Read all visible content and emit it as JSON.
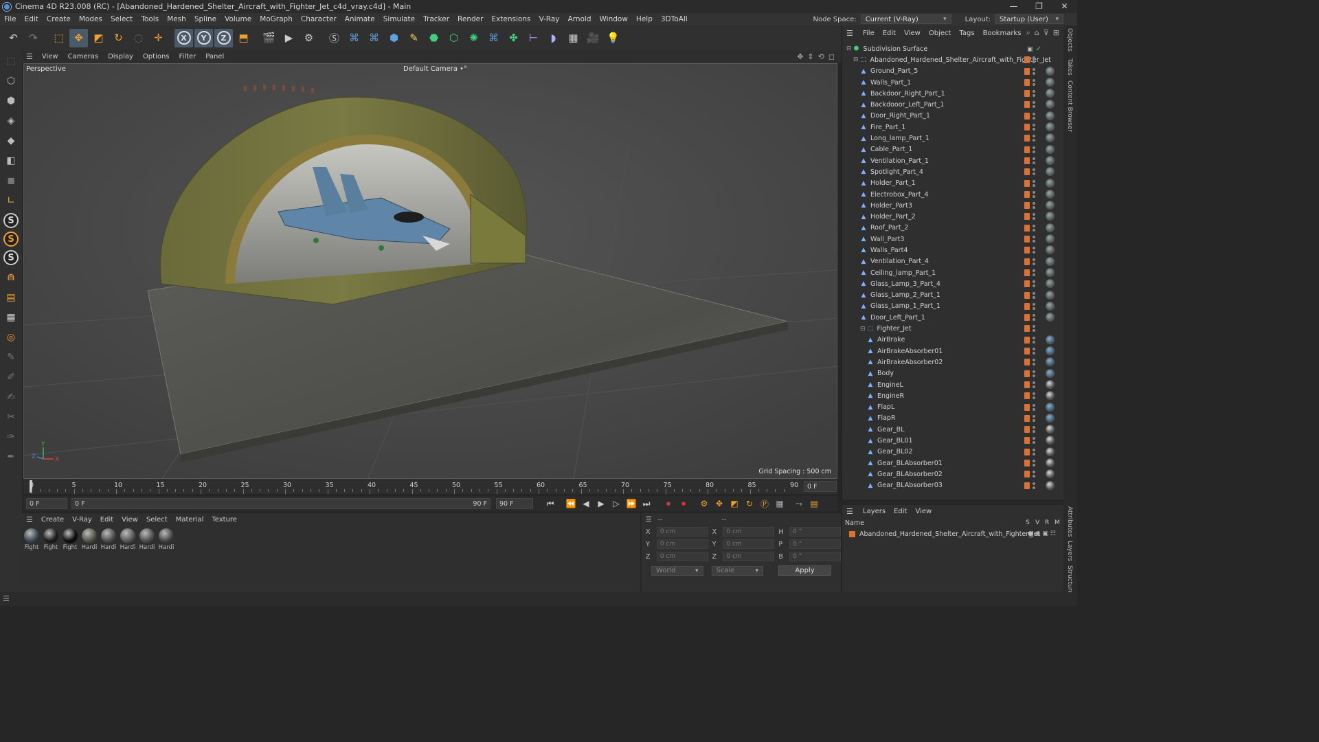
{
  "window": {
    "title": "Cinema 4D R23.008 (RC) - [Abandoned_Hardened_Shelter_Aircraft_with_Fighter_Jet_c4d_vray.c4d] - Main",
    "controls": [
      "—",
      "❐",
      "✕"
    ]
  },
  "menubar": {
    "items": [
      "File",
      "Edit",
      "Create",
      "Modes",
      "Select",
      "Tools",
      "Mesh",
      "Spline",
      "Volume",
      "MoGraph",
      "Character",
      "Animate",
      "Simulate",
      "Tracker",
      "Render",
      "Extensions",
      "V-Ray",
      "Arnold",
      "Window",
      "Help",
      "3DToAll"
    ],
    "node_space_label": "Node Space:",
    "node_space_value": "Current (V-Ray)",
    "layout_label": "Layout:",
    "layout_value": "Startup (User)"
  },
  "toolbar": {
    "icons": [
      "undo-icon",
      "redo-icon",
      "live-select-icon",
      "move-icon",
      "scale-icon",
      "rotate-icon",
      "recent-tools-icon",
      "transform-icon",
      "x-axis-icon",
      "y-axis-icon",
      "z-axis-icon",
      "coordinate-system-icon",
      "render-region-icon",
      "render-view-icon",
      "render-settings-icon",
      "vray-icon",
      "python-icon",
      "python2-icon",
      "cube-icon",
      "pen-icon",
      "subdivision-icon",
      "extrude-icon",
      "cloner-icon",
      "python3-icon",
      "mograph-icon",
      "symmetry-icon",
      "deformer-icon",
      "floor-icon",
      "camera-icon",
      "light-icon"
    ],
    "axis_labels": [
      "X",
      "Y",
      "Z"
    ]
  },
  "leftbar": {
    "icons": [
      "points-mode-icon",
      "edges-mode-icon",
      "polygons-mode-icon",
      "model-mode-icon",
      "texture-mode-icon",
      "workplane-icon",
      "snap-icon",
      "s-tool-1-icon",
      "s-tool-2-icon",
      "s-tool-3-icon",
      "magnet-icon",
      "floor-grid-icon",
      "grid-icon",
      "axis-lock-icon",
      "brush-icon",
      "sculpt-icon",
      "paint-icon",
      "relax-icon",
      "knife-icon"
    ]
  },
  "viewport": {
    "menu": [
      "View",
      "Cameras",
      "Display",
      "Options",
      "Filter",
      "Panel"
    ],
    "view_label": "Perspective",
    "camera_label": "Default Camera •°",
    "grid_spacing": "Grid Spacing : 500 cm",
    "axis_x": "X",
    "axis_y": "Y",
    "axis_z": "Z"
  },
  "timeline": {
    "ticks": [
      "0",
      "5",
      "10",
      "15",
      "20",
      "25",
      "30",
      "35",
      "40",
      "45",
      "50",
      "55",
      "60",
      "65",
      "70",
      "75",
      "80",
      "85",
      "90"
    ],
    "current_frame_label": "0 F"
  },
  "transport": {
    "start_frame": "0 F",
    "current": "0 F",
    "end_frame_1": "90 F",
    "end_frame_2": "90 F"
  },
  "materials": {
    "menu": [
      "Create",
      "V-Ray",
      "Edit",
      "View",
      "Select",
      "Material",
      "Texture"
    ],
    "items": [
      {
        "name": "Fight",
        "color": "#3c4a55"
      },
      {
        "name": "Fight",
        "color": "#1d1d1d"
      },
      {
        "name": "Fight",
        "color": "#0d0d0d"
      },
      {
        "name": "Hardi",
        "color": "#55554a"
      },
      {
        "name": "Hardi",
        "color": "#4d4d4d"
      },
      {
        "name": "Hardi",
        "color": "#5a5a5a"
      },
      {
        "name": "Hardi",
        "color": "#505050"
      },
      {
        "name": "Hardi",
        "color": "#474747"
      }
    ]
  },
  "attributes": {
    "header": "--",
    "header2": "--",
    "rows": [
      {
        "l1": "X",
        "v1": "0 cm",
        "l2": "X",
        "v2": "0 cm",
        "l3": "H",
        "v3": "0 °"
      },
      {
        "l1": "Y",
        "v1": "0 cm",
        "l2": "Y",
        "v2": "0 cm",
        "l3": "P",
        "v3": "0 °"
      },
      {
        "l1": "Z",
        "v1": "0 cm",
        "l2": "Z",
        "v2": "0 cm",
        "l3": "B",
        "v3": "0 °"
      }
    ],
    "coord_mode": "World",
    "size_mode": "Scale",
    "apply": "Apply"
  },
  "object_manager": {
    "menu": [
      "File",
      "Edit",
      "View",
      "Object",
      "Tags",
      "Bookmarks"
    ],
    "objects": [
      {
        "name": "Subdivision Surface",
        "level": 0,
        "kind": "subdiv",
        "mat": ""
      },
      {
        "name": "Abandoned_Hardened_Shelter_Aircraft_with_Fighter_Jet",
        "level": 1,
        "kind": "null",
        "mat": ""
      },
      {
        "name": "Ground_Part_5",
        "level": 2,
        "kind": "poly",
        "mat": "grey"
      },
      {
        "name": "Walls_Part_1",
        "level": 2,
        "kind": "poly",
        "mat": "grey"
      },
      {
        "name": "Backdoor_Right_Part_1",
        "level": 2,
        "kind": "poly",
        "mat": "grey"
      },
      {
        "name": "Backdooor_Left_Part_1",
        "level": 2,
        "kind": "poly",
        "mat": "grey"
      },
      {
        "name": "Door_Right_Part_1",
        "level": 2,
        "kind": "poly",
        "mat": "grey"
      },
      {
        "name": "Fire_Part_1",
        "level": 2,
        "kind": "poly",
        "mat": "grey"
      },
      {
        "name": "Long_lamp_Part_1",
        "level": 2,
        "kind": "poly",
        "mat": "grey"
      },
      {
        "name": "Cable_Part_1",
        "level": 2,
        "kind": "poly",
        "mat": "grey"
      },
      {
        "name": "Ventilation_Part_1",
        "level": 2,
        "kind": "poly",
        "mat": "grey"
      },
      {
        "name": "Spotlight_Part_4",
        "level": 2,
        "kind": "poly",
        "mat": "grey"
      },
      {
        "name": "Holder_Part_1",
        "level": 2,
        "kind": "poly",
        "mat": "grey"
      },
      {
        "name": "Electrobox_Part_4",
        "level": 2,
        "kind": "poly",
        "mat": "grey"
      },
      {
        "name": "Holder_Part3",
        "level": 2,
        "kind": "poly",
        "mat": "grey"
      },
      {
        "name": "Holder_Part_2",
        "level": 2,
        "kind": "poly",
        "mat": "grey"
      },
      {
        "name": "Roof_Part_2",
        "level": 2,
        "kind": "poly",
        "mat": "grey"
      },
      {
        "name": "Wall_Part3",
        "level": 2,
        "kind": "poly",
        "mat": "grey"
      },
      {
        "name": "Walls_Part4",
        "level": 2,
        "kind": "poly",
        "mat": "grey"
      },
      {
        "name": "Ventilation_Part_4",
        "level": 2,
        "kind": "poly",
        "mat": "grey"
      },
      {
        "name": "Ceiling_lamp_Part_1",
        "level": 2,
        "kind": "poly",
        "mat": "grey"
      },
      {
        "name": "Glass_Lamp_3_Part_4",
        "level": 2,
        "kind": "poly",
        "mat": "grey"
      },
      {
        "name": "Glass_Lamp_2_Part_1",
        "level": 2,
        "kind": "poly",
        "mat": "grey"
      },
      {
        "name": "Glass_Lamp_1_Part_1",
        "level": 2,
        "kind": "poly",
        "mat": "grey"
      },
      {
        "name": "Door_Left_Part_1",
        "level": 2,
        "kind": "poly",
        "mat": "grey"
      },
      {
        "name": "Fighter_Jet",
        "level": 2,
        "kind": "null",
        "mat": ""
      },
      {
        "name": "AirBrake",
        "level": 3,
        "kind": "poly",
        "mat": "blue"
      },
      {
        "name": "AirBrakeAbsorber01",
        "level": 3,
        "kind": "poly",
        "mat": "blue"
      },
      {
        "name": "AirBrakeAbsorber02",
        "level": 3,
        "kind": "poly",
        "mat": "blue"
      },
      {
        "name": "Body",
        "level": 3,
        "kind": "poly",
        "mat": "blue"
      },
      {
        "name": "EngineL",
        "level": 3,
        "kind": "poly",
        "mat": "dark"
      },
      {
        "name": "EngineR",
        "level": 3,
        "kind": "poly",
        "mat": "dark"
      },
      {
        "name": "FlapL",
        "level": 3,
        "kind": "poly",
        "mat": "blue"
      },
      {
        "name": "FlapR",
        "level": 3,
        "kind": "poly",
        "mat": "blue"
      },
      {
        "name": "Gear_BL",
        "level": 3,
        "kind": "poly",
        "mat": "dark"
      },
      {
        "name": "Gear_BL01",
        "level": 3,
        "kind": "poly",
        "mat": "dark"
      },
      {
        "name": "Gear_BL02",
        "level": 3,
        "kind": "poly",
        "mat": "dark"
      },
      {
        "name": "Gear_BLAbsorber01",
        "level": 3,
        "kind": "poly",
        "mat": "dark"
      },
      {
        "name": "Gear_BLAbsorber02",
        "level": 3,
        "kind": "poly",
        "mat": "dark"
      },
      {
        "name": "Gear_BLAbsorber03",
        "level": 3,
        "kind": "poly",
        "mat": "dark"
      }
    ]
  },
  "layers": {
    "menu": [
      "Layers",
      "Edit",
      "View"
    ],
    "col_name": "Name",
    "col_flags": [
      "S",
      "V",
      "R",
      "M"
    ],
    "items": [
      {
        "name": "Abandoned_Hardened_Shelter_Aircraft_with_Fighter_Jet",
        "color": "#e07030"
      }
    ]
  },
  "side_tabs": [
    "Objects",
    "Takes",
    "Content Browser",
    "Attributes",
    "Layers",
    "Structure"
  ]
}
